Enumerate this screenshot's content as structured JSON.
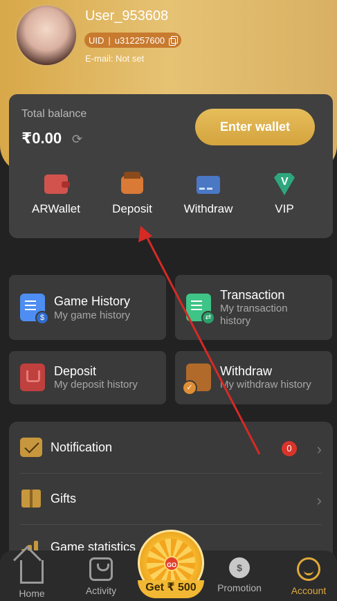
{
  "profile": {
    "username": "User_953608",
    "uid_label": "UID",
    "uid_sep": "|",
    "uid_value": "u312257600",
    "email": "E-mail: Not set"
  },
  "balance": {
    "label": "Total balance",
    "value": "₹0.00",
    "enter_wallet": "Enter wallet"
  },
  "quick_actions": [
    {
      "label": "ARWallet",
      "icon": "arwallet-icon"
    },
    {
      "label": "Deposit",
      "icon": "deposit-wallet-icon"
    },
    {
      "label": "Withdraw",
      "icon": "withdraw-card-icon"
    },
    {
      "label": "VIP",
      "icon": "vip-gem-icon"
    }
  ],
  "grid": [
    {
      "title": "Game History",
      "subtitle": "My game history",
      "icon": "game-history-icon"
    },
    {
      "title": "Transaction",
      "subtitle": "My transaction history",
      "icon": "transaction-icon"
    },
    {
      "title": "Deposit",
      "subtitle": "My deposit history",
      "icon": "deposit-history-icon"
    },
    {
      "title": "Withdraw",
      "subtitle": "My withdraw history",
      "icon": "withdraw-history-icon"
    }
  ],
  "menu": [
    {
      "label": "Notification",
      "badge": "0",
      "icon": "notification-mail-icon"
    },
    {
      "label": "Gifts",
      "icon": "gift-icon"
    },
    {
      "label": "Game statistics",
      "icon": "statistics-icon"
    }
  ],
  "spin": {
    "center": "GO",
    "label": "Get ₹ 500"
  },
  "nav": [
    {
      "label": "Home",
      "icon": "home-icon"
    },
    {
      "label": "Activity",
      "icon": "activity-icon"
    },
    {
      "label": "Promotion",
      "icon": "promotion-icon",
      "icon_text": "$"
    },
    {
      "label": "Account",
      "icon": "account-icon",
      "active": true
    }
  ],
  "colors": {
    "accent": "#e0a93b",
    "background": "#222222",
    "card": "#3a3a3a",
    "annotation_arrow": "#d62a25"
  }
}
